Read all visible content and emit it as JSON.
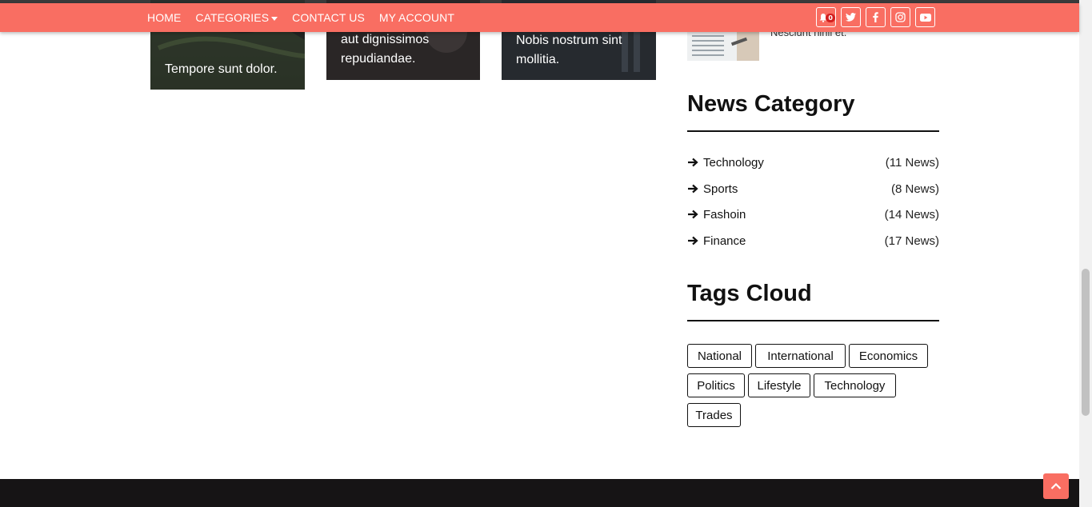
{
  "nav": {
    "links": [
      "HOME",
      "CATEGORIES",
      "CONTACT US",
      "MY ACCOUNT"
    ],
    "notification_count": "0",
    "icons": [
      "bell-icon",
      "twitter-icon",
      "facebook-icon",
      "instagram-icon",
      "youtube-icon"
    ]
  },
  "cards": [
    {
      "title": "Tempore sunt dolor."
    },
    {
      "title": "aut dignissimos repudiandae."
    },
    {
      "title": "Nobis nostrum sint mollitia."
    }
  ],
  "sidebar": {
    "recent_post_text": "Nesciunt nihil et.",
    "news_category_title": "News Category",
    "categories": [
      {
        "name": "Technology",
        "count": "(11 News)"
      },
      {
        "name": "Sports",
        "count": "(8 News)"
      },
      {
        "name": "Fashoin",
        "count": "(14 News)"
      },
      {
        "name": "Finance",
        "count": "(17 News)"
      }
    ],
    "tags_title": "Tags Cloud",
    "tags": [
      "National",
      "International",
      "Economics",
      "Politics",
      "Lifestyle",
      "Technology",
      "Trades"
    ]
  },
  "colors": {
    "accent": "#f96e62",
    "footer": "#161415"
  }
}
